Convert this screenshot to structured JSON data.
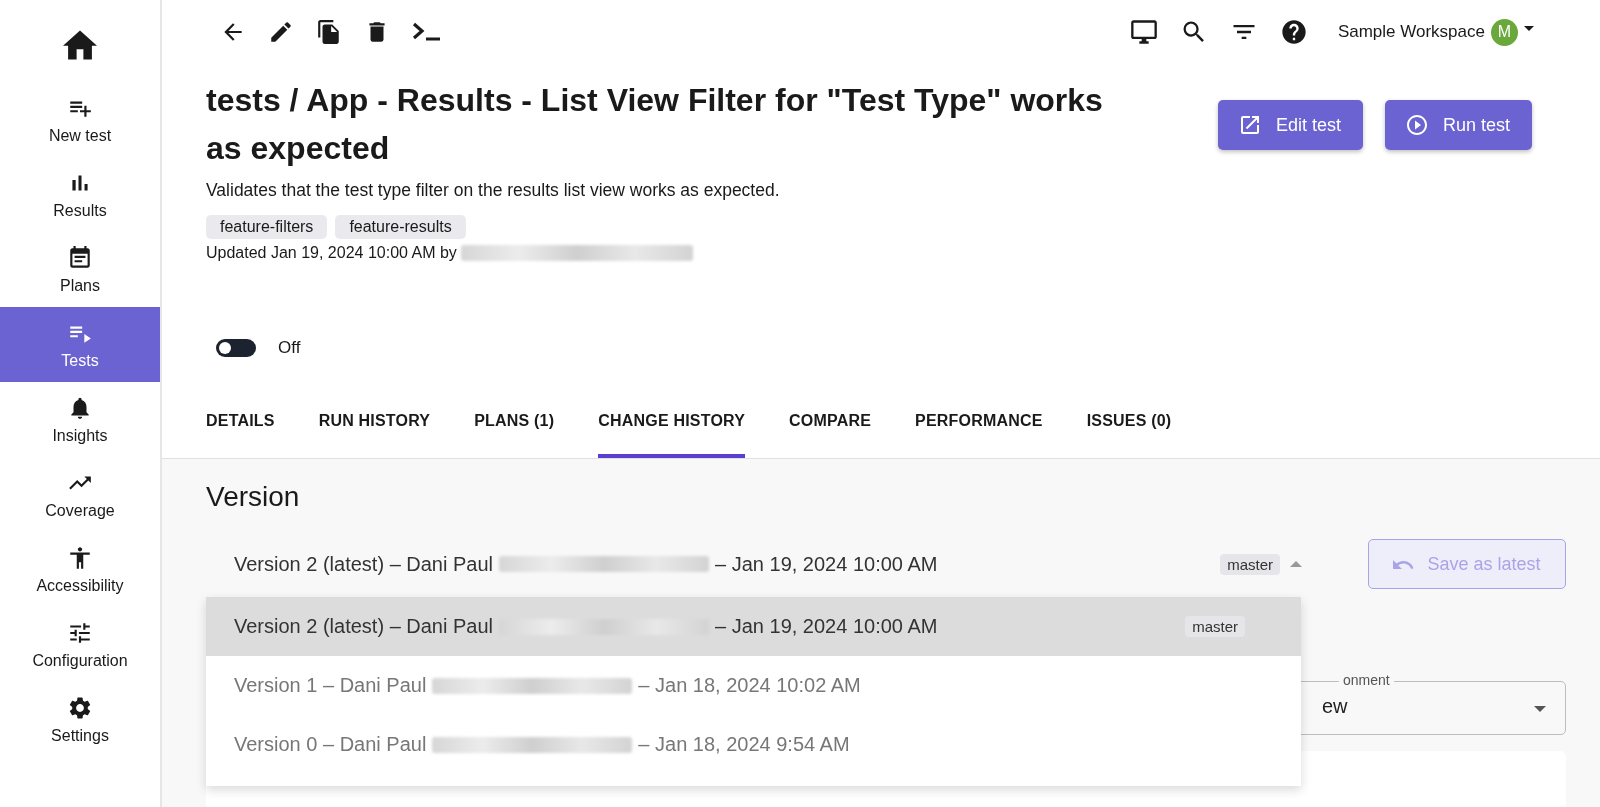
{
  "sidebar": {
    "items": [
      {
        "label": "New test",
        "selected": false
      },
      {
        "label": "Results",
        "selected": false
      },
      {
        "label": "Plans",
        "selected": false
      },
      {
        "label": "Tests",
        "selected": true
      },
      {
        "label": "Insights",
        "selected": false
      },
      {
        "label": "Coverage",
        "selected": false
      },
      {
        "label": "Accessibility",
        "selected": false
      },
      {
        "label": "Configuration",
        "selected": false
      },
      {
        "label": "Settings",
        "selected": false
      }
    ]
  },
  "header": {
    "workspace": "Sample Workspace",
    "avatar": "M"
  },
  "title": "tests / App - Results - List View Filter for \"Test Type\" works as expected",
  "description": "Validates that the test type filter on the results list view works as expected.",
  "tags": [
    "feature-filters",
    "feature-results"
  ],
  "updated": "Updated Jan 19, 2024 10:00 AM by",
  "buttons": [
    "Edit test",
    "Run test"
  ],
  "toggle": {
    "on": false,
    "label": "Off"
  },
  "tabs": [
    {
      "label": "DETAILS",
      "selected": false
    },
    {
      "label": "RUN HISTORY",
      "selected": false
    },
    {
      "label": "PLANS (1)",
      "selected": false
    },
    {
      "label": "CHANGE HISTORY",
      "selected": true
    },
    {
      "label": "COMPARE",
      "selected": false
    },
    {
      "label": "PERFORMANCE",
      "selected": false
    },
    {
      "label": "ISSUES (0)",
      "selected": false
    }
  ],
  "section_title": "Version",
  "version_select": {
    "expanded": true,
    "value": {
      "label": "Version 2 (latest) – Dani Paul",
      "date": "– Jan 19, 2024 10:00 AM",
      "branch": "master"
    },
    "options": [
      {
        "label": "Version 2 (latest) – Dani Paul",
        "date": "– Jan 19, 2024 10:00 AM",
        "branch": "master",
        "selected": true
      },
      {
        "label": "Version 1 – Dani Paul",
        "date": "– Jan 18, 2024 10:02 AM",
        "selected": false
      },
      {
        "label": "Version 0 – Dani Paul",
        "date": "– Jan 18, 2024 9:54 AM",
        "selected": false
      }
    ]
  },
  "save_button": {
    "label": "Save as latest",
    "disabled": true
  },
  "environment_field": {
    "label": "onment",
    "value": "ew"
  }
}
